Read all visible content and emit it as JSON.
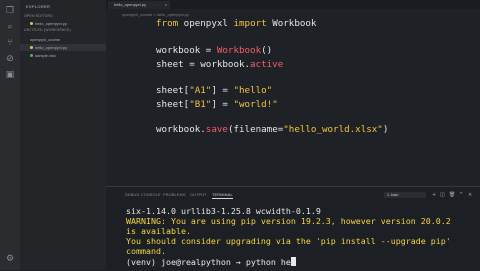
{
  "sidebar": {
    "title": "EXPLORER",
    "open_editors_label": "OPEN EDITORS",
    "open_file": "hello_openpyxl.py",
    "workspace_label": "UNTITLED (WORKSPACE)",
    "files": [
      {
        "name": "openpyxl_course"
      },
      {
        "name": "hello_openpyxl.py"
      },
      {
        "name": "sample.xlsx"
      }
    ]
  },
  "tab": {
    "label": "hello_openpyxl.py",
    "close": "×"
  },
  "breadcrumb": "openpyxl_course  >  hello_openpyxl.py",
  "code": {
    "line1_kw1": "from",
    "line1_mod": " openpyxl ",
    "line1_kw2": "import",
    "line1_name": " Workbook",
    "line2_a": "workbook = ",
    "line2_fn": "Workbook",
    "line2_b": "()",
    "line3_a": "sheet = workbook.",
    "line3_attr": "active",
    "line4_a": "sheet[",
    "line4_key": "\"A1\"",
    "line4_b": "] = ",
    "line4_val": "\"hello\"",
    "line5_a": "sheet[",
    "line5_key": "\"B1\"",
    "line5_b": "] = ",
    "line5_val": "\"world!\"",
    "line6_a": "workbook.",
    "line6_fn": "save",
    "line6_b": "(filename=",
    "line6_val": "\"hello_world.xlsx\"",
    "line6_c": ")"
  },
  "panel": {
    "tabs": [
      "DEBUG CONSOLE",
      "PROBLEMS",
      "OUTPUT",
      "TERMINAL"
    ],
    "terminal_select": "1: bash",
    "tool_icons": [
      "plus-icon",
      "split-icon",
      "trash-icon",
      "chevron-up-icon",
      "close-icon"
    ],
    "tool_glyphs": [
      "+",
      "◫",
      "🗑",
      "^",
      "×"
    ]
  },
  "terminal": {
    "line1": "six-1.14.0 urllib3-1.25.8 wcwidth-0.1.9",
    "line2": "WARNING: You are using pip version 19.2.3, however version 20.0.2",
    "line3": "is available.",
    "line4": "You should consider upgrading via the 'pip install --upgrade pip'",
    "line5": "command.",
    "line6": "(venv) joe@realpython → python he"
  },
  "activity_icons": [
    "files-icon",
    "search-icon",
    "source-control-icon",
    "debug-icon",
    "extensions-icon",
    "settings-icon"
  ],
  "activity_glyphs": [
    "❐",
    "⌕",
    "⑂",
    "⊘",
    "▣",
    "⚙"
  ]
}
